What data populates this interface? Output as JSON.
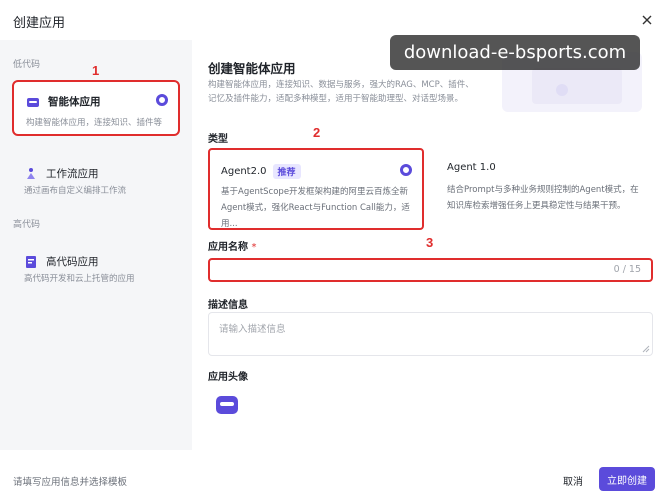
{
  "dialog": {
    "title": "创建应用",
    "close_icon": "close-icon"
  },
  "sidebar": {
    "section_lowcode": "低代码",
    "section_highcode": "高代码",
    "items": [
      {
        "label": "智能体应用",
        "desc": "构建智能体应用，连接知识、插件等",
        "icon": "agent-app-icon",
        "selected": true
      },
      {
        "label": "工作流应用",
        "desc": "通过画布自定义编排工作流",
        "icon": "workflow-icon",
        "selected": false
      },
      {
        "label": "高代码应用",
        "desc": "高代码开发和云上托管的应用",
        "icon": "high-code-icon",
        "selected": false
      }
    ]
  },
  "main": {
    "title": "创建智能体应用",
    "desc": "构建智能体应用，连接知识、数据与服务，强大的RAG、MCP、插件、记忆及插件能力，适配多种模型，适用于智能助理型、对话型场景。",
    "type_label": "类型",
    "types": [
      {
        "name": "Agent2.0",
        "badge": "推荐",
        "desc": "基于AgentScope开发框架构建的阿里云百炼全新Agent模式，强化React与Function Call能力，适用...",
        "selected": true
      },
      {
        "name": "Agent 1.0",
        "badge": "",
        "desc": "结合Prompt与多种业务规则控制的Agent模式，在知识库检索增强任务上更具稳定性与结果干预。",
        "selected": false
      }
    ],
    "name_label": "应用名称",
    "required_mark": "*",
    "name_value": "",
    "name_counter": "0 / 15",
    "desc_label": "描述信息",
    "desc_placeholder": "请输入描述信息",
    "avatar_label": "应用头像"
  },
  "footer": {
    "hint": "请填写应用信息并选择模板",
    "cancel": "取消",
    "create": "立即创建"
  },
  "annotations": {
    "one": "1",
    "two": "2",
    "three": "3"
  },
  "watermark": "download-e-bsports.com",
  "colors": {
    "accent": "#5b4bdb",
    "highlight": "#e02d2d",
    "sidebar_bg": "#f5f6f8"
  }
}
